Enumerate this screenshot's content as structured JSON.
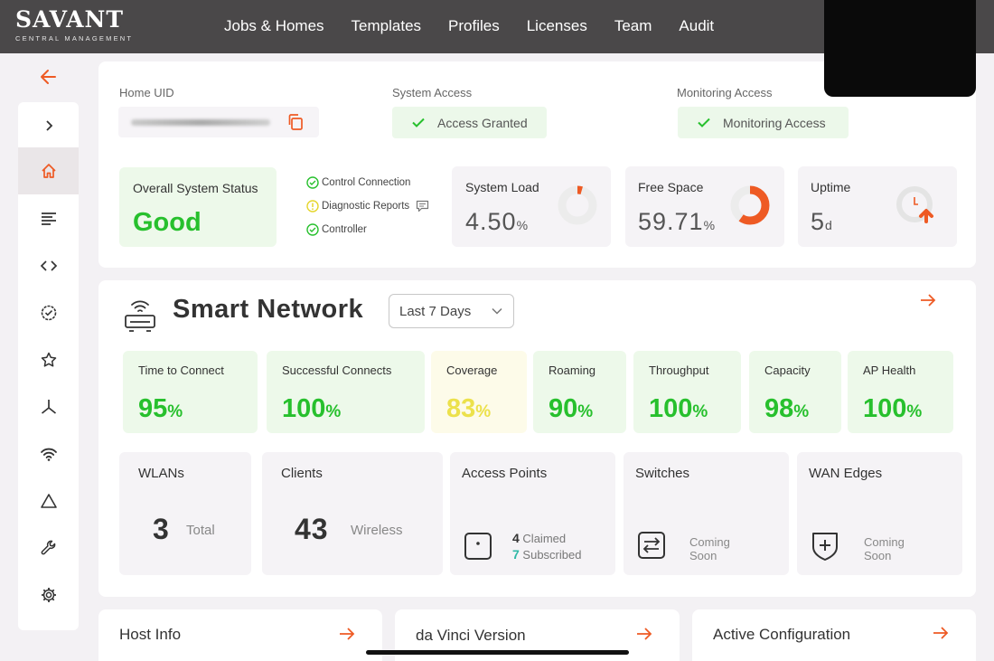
{
  "brand": {
    "name": "SAVANT",
    "subtitle": "CENTRAL MANAGEMENT"
  },
  "nav": [
    "Jobs & Homes",
    "Templates",
    "Profiles",
    "Licenses",
    "Team",
    "Audit"
  ],
  "sidebar": {
    "items": [
      "chevron-right-icon",
      "home-icon",
      "list-icon",
      "code-icon",
      "badge-check-icon",
      "star-icon",
      "network-icon",
      "wifi-icon",
      "triangle-icon",
      "wrench-icon",
      "gear-icon"
    ],
    "active": "home-icon"
  },
  "home": {
    "uid_label": "Home UID",
    "system_access_label": "System Access",
    "system_access_value": "Access Granted",
    "monitoring_label": "Monitoring Access",
    "monitoring_value": "Monitoring Access"
  },
  "status": {
    "title": "Overall System Status",
    "value": "Good",
    "checks": [
      "Control Connection",
      "Diagnostic Reports",
      "Controller"
    ]
  },
  "metrics": [
    {
      "title": "System Load",
      "value": "4.50",
      "unit": "%",
      "fraction": 0.045
    },
    {
      "title": "Free Space",
      "value": "59.71",
      "unit": "%",
      "fraction": 0.5971
    },
    {
      "title": "Uptime",
      "value": "5",
      "unit": "d"
    }
  ],
  "smart_network": {
    "title": "Smart Network",
    "range": "Last 7 Days",
    "tiles": [
      {
        "title": "Time to Connect",
        "value": "95",
        "unit": "%"
      },
      {
        "title": "Successful Connects",
        "value": "100",
        "unit": "%"
      },
      {
        "title": "Coverage",
        "value": "83",
        "unit": "%"
      },
      {
        "title": "Roaming",
        "value": "90",
        "unit": "%"
      },
      {
        "title": "Throughput",
        "value": "100",
        "unit": "%"
      },
      {
        "title": "Capacity",
        "value": "98",
        "unit": "%"
      },
      {
        "title": "AP Health",
        "value": "100",
        "unit": "%"
      }
    ],
    "wlans": {
      "title": "WLANs",
      "value": "3",
      "label": "Total"
    },
    "clients": {
      "title": "Clients",
      "value": "43",
      "label": "Wireless"
    },
    "access_points": {
      "title": "Access Points",
      "claimed": "4",
      "claimed_label": "Claimed",
      "subscribed": "7",
      "subscribed_label": "Subscribed"
    },
    "switches": {
      "title": "Switches",
      "status": "Coming Soon"
    },
    "wan_edges": {
      "title": "WAN Edges",
      "status": "Coming Soon"
    }
  },
  "bottom": {
    "host_info": "Host Info",
    "davinci": "da Vinci Version",
    "active_config": "Active Configuration"
  },
  "colors": {
    "accent": "#ee5a24",
    "good": "#27c02d",
    "warn": "#ece14b",
    "header": "#4a4849"
  }
}
